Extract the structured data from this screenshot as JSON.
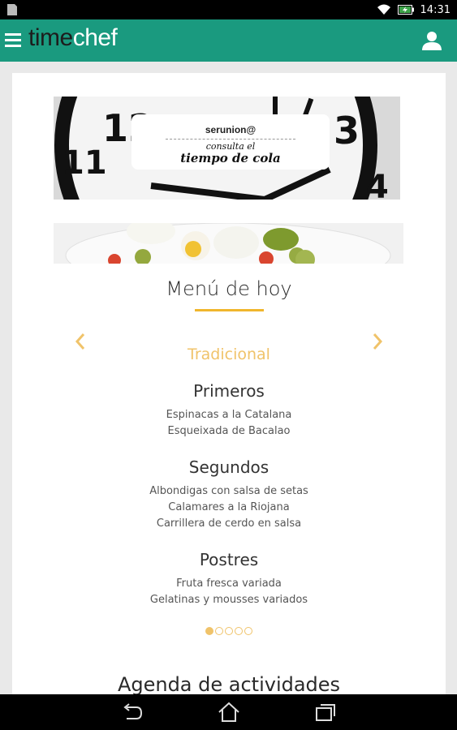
{
  "status_bar": {
    "time": "14:31",
    "icons": [
      "sim-icon",
      "wifi-icon",
      "battery-charging-icon"
    ]
  },
  "app_bar": {
    "logo_part1": "time",
    "logo_part2": "chef",
    "icons": [
      "hamburger-menu-icon",
      "user-icon"
    ]
  },
  "banner": {
    "brand": "serunion@",
    "line1": "consulta el",
    "line2": "tiempo de cola"
  },
  "menu": {
    "title": "Menú de hoy",
    "type": "Tradicional",
    "courses": [
      {
        "name": "Primeros",
        "items": [
          "Espinacas a la Catalana",
          "Esqueixada de Bacalao"
        ]
      },
      {
        "name": "Segundos",
        "items": [
          "Albondigas con salsa de setas",
          "Calamares a la Riojana",
          "Carrillera de cerdo en salsa"
        ]
      },
      {
        "name": "Postres",
        "items": [
          "Fruta fresca variada",
          "Gelatinas y mousses variados"
        ]
      }
    ],
    "pager": {
      "total": 5,
      "active_index": 0
    }
  },
  "agenda": {
    "title": "Agenda de actividades"
  },
  "colors": {
    "app_bar": "#1a9a7f",
    "accent_gold": "#f0b62d",
    "menu_type": "#f0c36a"
  }
}
